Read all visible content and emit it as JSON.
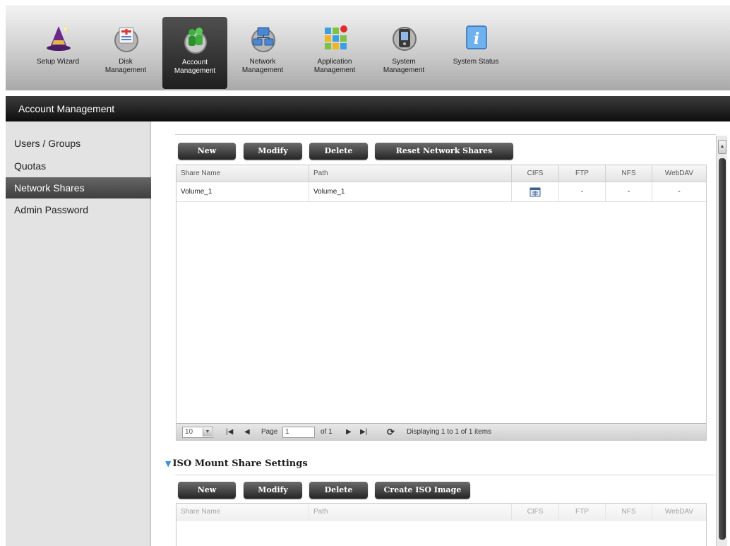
{
  "toolbar": {
    "items": [
      {
        "label": "Setup Wizard"
      },
      {
        "label": "Disk\nManagement"
      },
      {
        "label": "Account\nManagement"
      },
      {
        "label": "Network\nManagement"
      },
      {
        "label": "Application\nManagement"
      },
      {
        "label": "System\nManagement"
      },
      {
        "label": "System Status"
      }
    ],
    "active": "Account Management"
  },
  "section": {
    "title": "Account Management"
  },
  "sidebar": {
    "items": [
      {
        "label": "Users / Groups"
      },
      {
        "label": "Quotas"
      },
      {
        "label": "Network Shares"
      },
      {
        "label": "Admin Password"
      }
    ],
    "active": "Network Shares"
  },
  "shares": {
    "buttons": {
      "new": "New",
      "modify": "Modify",
      "delete": "Delete",
      "reset": "Reset Network Shares"
    },
    "columns": [
      "Share Name",
      "Path",
      "CIFS",
      "FTP",
      "NFS",
      "WebDAV"
    ],
    "rows": [
      {
        "share_name": "Volume_1",
        "path": "Volume_1",
        "cifs": "cifs-icon",
        "ftp": "-",
        "nfs": "-",
        "webdav": "-"
      }
    ],
    "pager": {
      "page_size": "10",
      "page_label": "Page",
      "page_value": "1",
      "of_label": "of 1",
      "status": "Displaying 1 to 1 of 1 items"
    }
  },
  "iso": {
    "title": "ISO Mount Share Settings",
    "buttons": {
      "new": "New",
      "modify": "Modify",
      "delete": "Delete",
      "create": "Create ISO Image"
    },
    "columns": [
      "Share Name",
      "Path",
      "CIFS",
      "FTP",
      "NFS",
      "WebDAV"
    ]
  },
  "colors": {
    "accent": "#3a8fd8",
    "active_tab": "#2a2a2a",
    "header_bar": "#1a1a1a"
  }
}
